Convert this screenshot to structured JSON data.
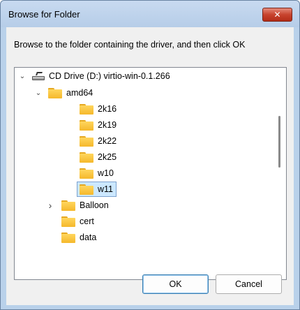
{
  "window": {
    "title": "Browse for Folder",
    "close_glyph": "✕"
  },
  "prompt": "Browse to the folder containing the driver, and then click OK",
  "tree": {
    "drive": {
      "label": "CD Drive (D:) virtio-win-0.1.266",
      "expanded": true,
      "icon": "cd-drive-icon"
    },
    "amd64": {
      "label": "amd64",
      "expanded": true,
      "icon": "folder-icon"
    },
    "amd64_children": [
      {
        "label": "2k16"
      },
      {
        "label": "2k19"
      },
      {
        "label": "2k22"
      },
      {
        "label": "2k25"
      },
      {
        "label": "w10"
      },
      {
        "label": "w11",
        "selected": true
      }
    ],
    "siblings": [
      {
        "label": "Balloon",
        "collapsed_children": true
      },
      {
        "label": "cert"
      },
      {
        "label": "data"
      }
    ],
    "chevron_expanded": "⌄",
    "chevron_collapsed": "›"
  },
  "buttons": {
    "ok": "OK",
    "cancel": "Cancel"
  },
  "colors": {
    "title_bar": "#b9d1ea",
    "close_button": "#c7432e",
    "selection": "#cce8ff",
    "folder": "#f5b82b"
  }
}
